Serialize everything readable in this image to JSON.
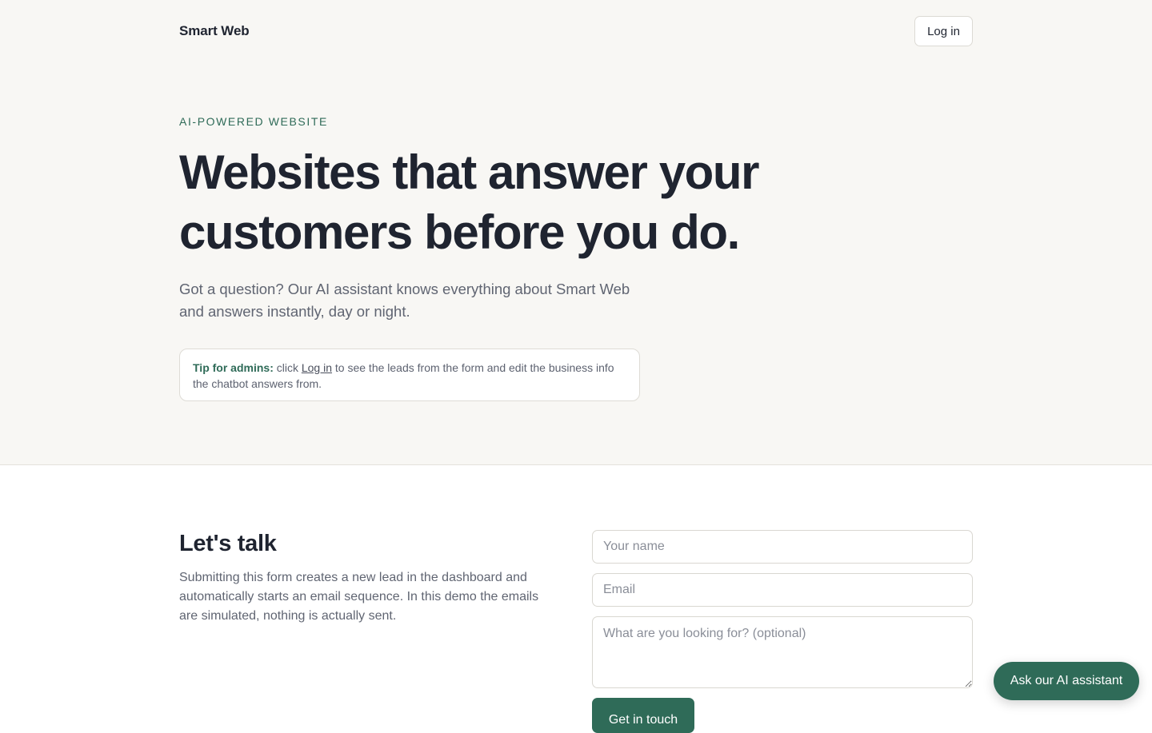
{
  "header": {
    "brand": "Smart Web",
    "login_label": "Log in"
  },
  "hero": {
    "eyebrow": "AI-POWERED WEBSITE",
    "headline": "Websites that answer your customers before you do.",
    "subtext": "Got a question? Our AI assistant knows everything about Smart Web and answers instantly, day or night.",
    "tip": {
      "label": "Tip for admins:",
      "before_link": " click ",
      "link_text": "Log in",
      "after_link": " to see the leads from the form and edit the business info the chatbot answers from."
    }
  },
  "contact": {
    "title": "Let's talk",
    "description": "Submitting this form creates a new lead in the dashboard and automatically starts an email sequence. In this demo the emails are simulated, nothing is actually sent.",
    "name_placeholder": "Your name",
    "email_placeholder": "Email",
    "message_placeholder": "What are you looking for? (optional)",
    "submit_label": "Get in touch"
  },
  "assistant": {
    "button_label": "Ask our AI assistant"
  },
  "colors": {
    "accent": "#2f6b58",
    "hero_background": "#f8f7f4",
    "text": "#1f2430"
  }
}
